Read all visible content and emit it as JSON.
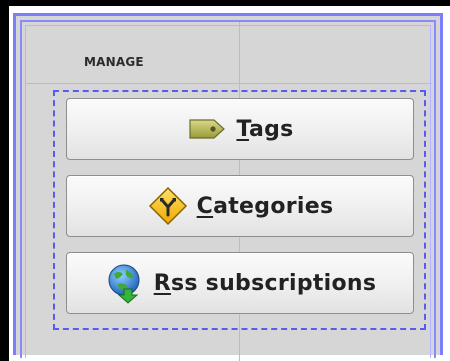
{
  "manage": {
    "section_label": "MANAGE",
    "buttons": [
      {
        "mnemonic": "T",
        "rest": "ags",
        "icon": "tag-icon"
      },
      {
        "mnemonic": "C",
        "rest": "ategories",
        "icon": "category-diamond-icon"
      },
      {
        "mnemonic": "R",
        "rest": "ss subscriptions",
        "icon": "rss-globe-icon"
      }
    ]
  },
  "colors": {
    "guide_border": "#7c7cff",
    "dashed_outline": "#5a5af0",
    "panel_background": "#d6d6d6"
  }
}
